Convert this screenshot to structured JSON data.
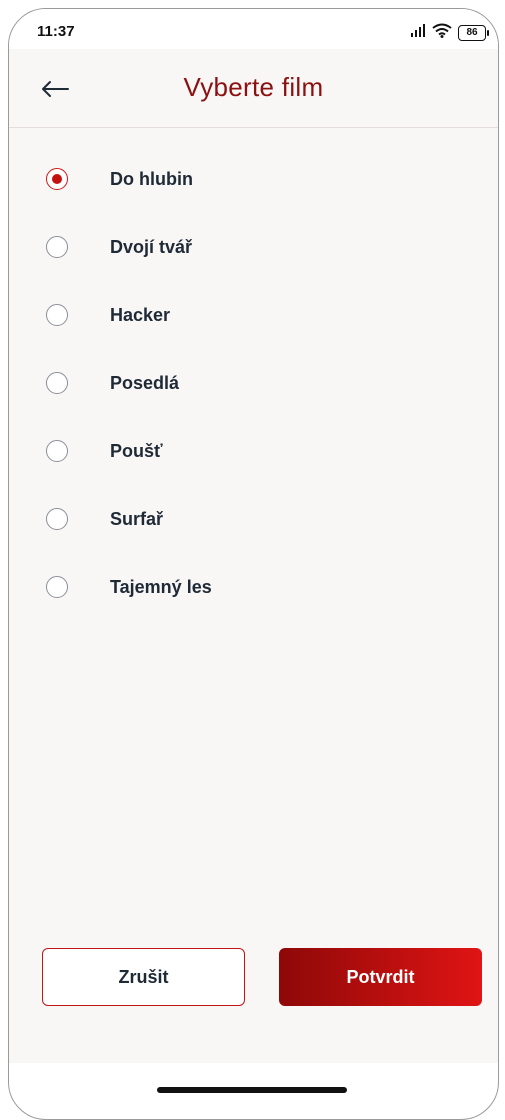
{
  "status_bar": {
    "time": "11:37",
    "battery": "86",
    "icons": [
      "signal-icon",
      "wifi-icon",
      "battery-icon"
    ]
  },
  "header": {
    "back_icon": "arrow-left-icon",
    "title": "Vyberte film"
  },
  "options": [
    {
      "label": "Do hlubin",
      "selected": true
    },
    {
      "label": "Dvojí tvář",
      "selected": false
    },
    {
      "label": "Hacker",
      "selected": false
    },
    {
      "label": "Posedlá",
      "selected": false
    },
    {
      "label": "Poušť",
      "selected": false
    },
    {
      "label": "Surfař",
      "selected": false
    },
    {
      "label": "Tajemný les",
      "selected": false
    }
  ],
  "buttons": {
    "cancel_label": "Zrušit",
    "confirm_label": "Potvrdit"
  },
  "colors": {
    "accent": "#8b1111",
    "radio_selected": "#c51010",
    "confirm_gradient_start": "#8e0808",
    "confirm_gradient_end": "#e01414",
    "background": "#f9f6f6"
  }
}
